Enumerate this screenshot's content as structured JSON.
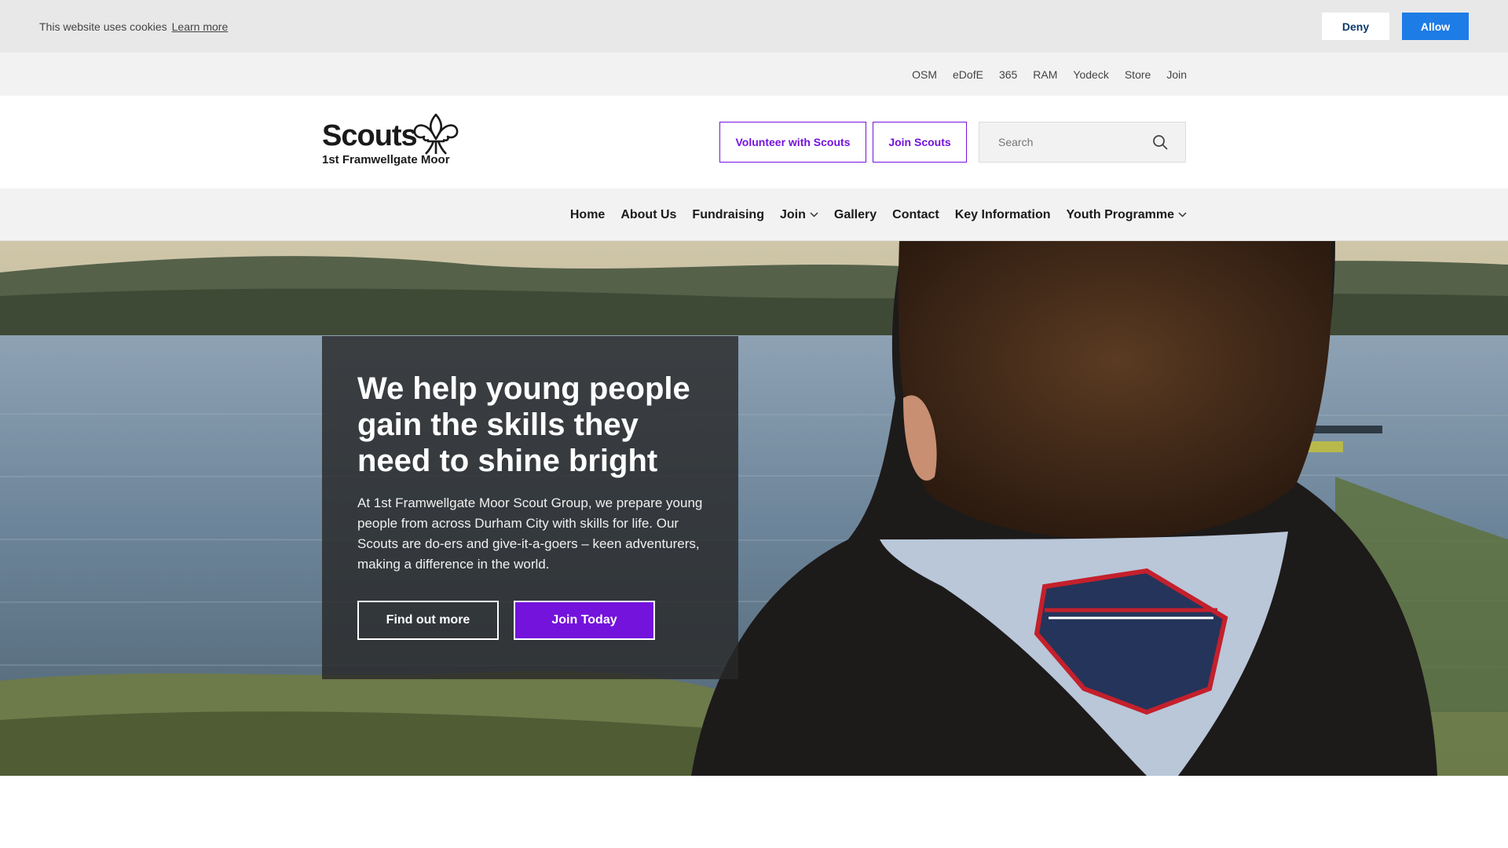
{
  "cookie": {
    "text": "This website uses cookies",
    "learn_more": "Learn more",
    "deny": "Deny",
    "allow": "Allow"
  },
  "utility_links": [
    "OSM",
    "eDofE",
    "365",
    "RAM",
    "Yodeck",
    "Store",
    "Join"
  ],
  "logo": {
    "word": "Scouts",
    "group": "1st Framwellgate Moor"
  },
  "header": {
    "volunteer_button": "Volunteer with Scouts",
    "join_button": "Join Scouts",
    "search_placeholder": "Search"
  },
  "nav": [
    {
      "label": "Home",
      "dropdown": false
    },
    {
      "label": "About Us",
      "dropdown": false
    },
    {
      "label": "Fundraising",
      "dropdown": false
    },
    {
      "label": "Join",
      "dropdown": true
    },
    {
      "label": "Gallery",
      "dropdown": false
    },
    {
      "label": "Contact",
      "dropdown": false
    },
    {
      "label": "Key Information",
      "dropdown": false
    },
    {
      "label": "Youth Programme",
      "dropdown": true
    }
  ],
  "hero": {
    "title": "We help young people gain the skills they need to shine bright",
    "text": "At 1st Framwellgate Moor Scout Group, we prepare young people from across Durham City with skills for life. Our Scouts are do-ers and give-it-a-goers – keen adventurers, making a difference in the world.",
    "find_out_more": "Find out more",
    "join_today": "Join Today"
  },
  "colors": {
    "brand_purple": "#7413dc",
    "cookie_allow": "#1e7ce6"
  }
}
